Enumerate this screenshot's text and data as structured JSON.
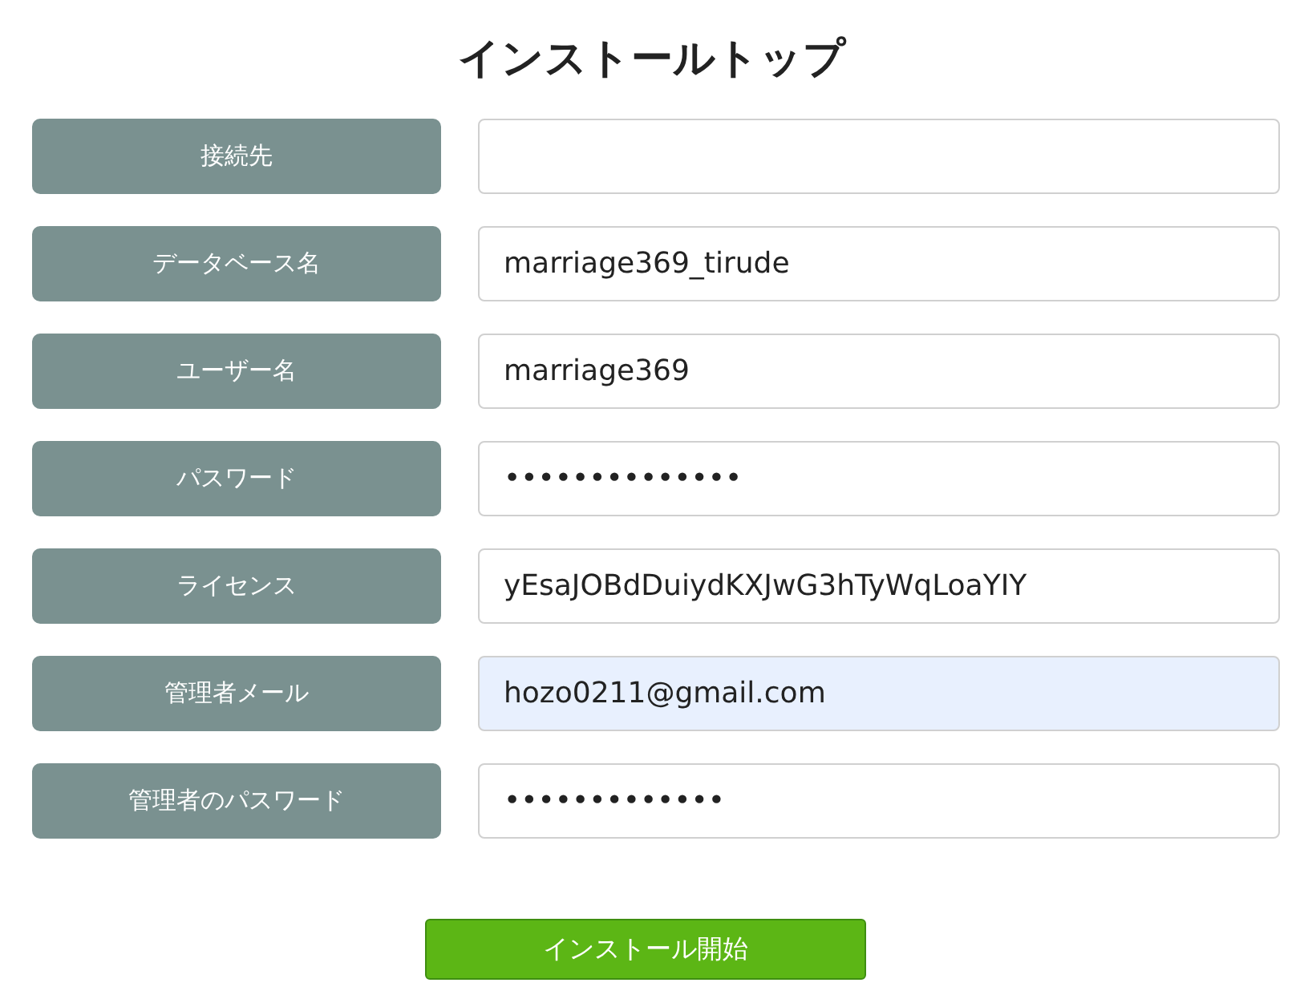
{
  "title": "インストールトップ",
  "fields": [
    {
      "label": "接続先",
      "autofilled": false
    },
    {
      "label": "データベース名",
      "value": "marriage369_tirude",
      "autofilled": false
    },
    {
      "label": "ユーザー名",
      "value": "marriage369",
      "autofilled": false
    },
    {
      "label": "パスワード",
      "value": "••••••••••••••",
      "autofilled": false
    },
    {
      "label": "ライセンス",
      "value": "yEsaJOBdDuiydKXJwG3hTyWqLoaYIY",
      "autofilled": false
    },
    {
      "label": "管理者メール",
      "value": "hozo0211@gmail.com",
      "autofilled": true
    },
    {
      "label": "管理者のパスワード",
      "value": "•••••••••••••",
      "autofilled": false
    }
  ],
  "submit_button": "インストール開始"
}
